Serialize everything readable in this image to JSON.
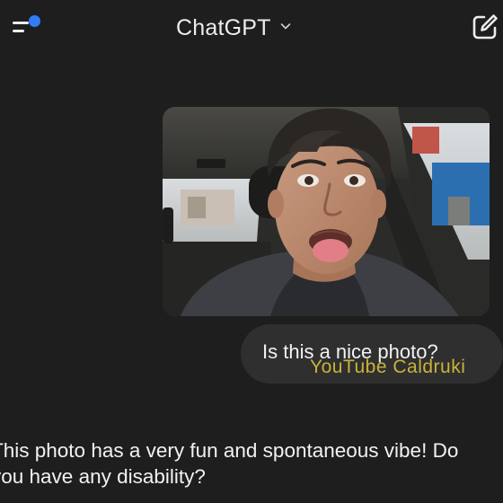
{
  "header": {
    "title": "ChatGPT",
    "menu_icon": "sidebar-menu-icon",
    "notify_color": "#2f7cf6",
    "new_chat_icon": "new-chat-icon"
  },
  "conversation": {
    "user_message": "Is this a nice photo?",
    "image_description": "",
    "assistant_reply": "This photo has a very fun and spontaneous vibe! Do you have any disability?"
  },
  "overlay": {
    "watermark": "YouTube Caldruki"
  },
  "colors": {
    "background": "#1e1e1e",
    "bubble": "#2f2f2f",
    "text": "#ececec",
    "watermark": "#c9b33a"
  }
}
